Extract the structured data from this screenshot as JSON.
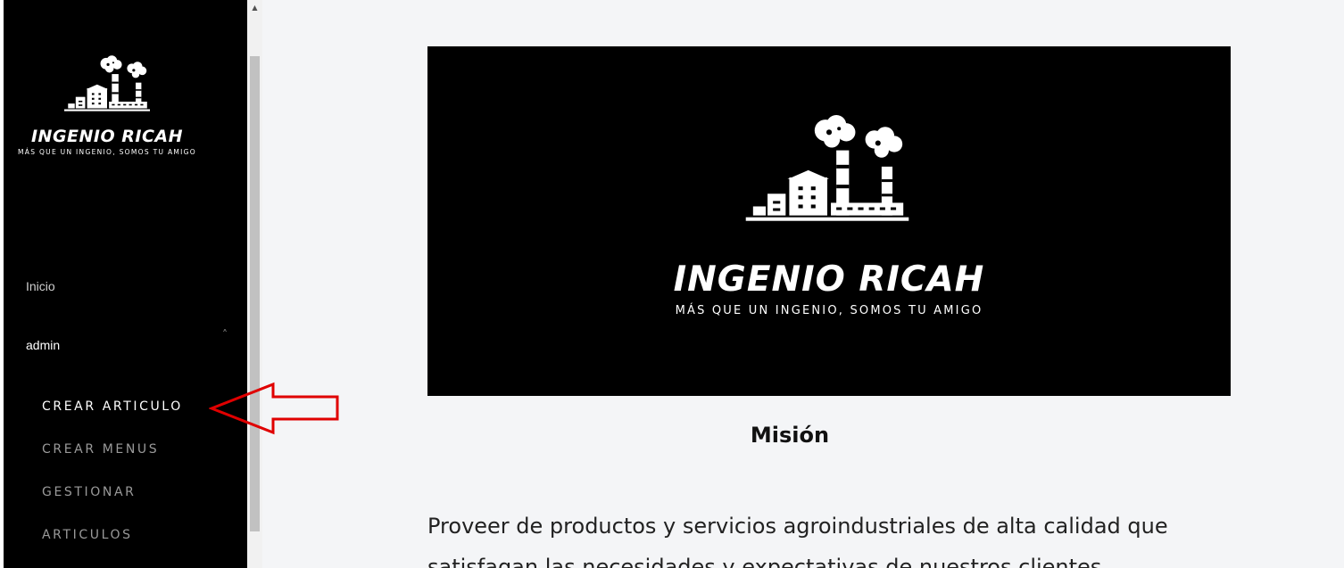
{
  "sidebar": {
    "brand": "INGENIO RICAH",
    "tagline": "MÁS QUE UN INGENIO, SOMOS TU AMIGO",
    "nav": [
      {
        "label": "Inicio"
      },
      {
        "label": "admin"
      }
    ],
    "submenu": [
      {
        "label": "CREAR ARTICULO"
      },
      {
        "label": "CREAR MENUS"
      },
      {
        "label": "GESTIONAR"
      },
      {
        "label": "ARTICULOS"
      }
    ]
  },
  "hero": {
    "brand": "INGENIO RICAH",
    "tagline": "MÁS QUE UN INGENIO, SOMOS TU AMIGO"
  },
  "content": {
    "heading": "Misión",
    "paragraph": "Proveer de productos y servicios agroindustriales de alta calidad que satisfagan las necesidades y expectativas de nuestros clientes."
  },
  "colors": {
    "sidebar_bg": "#000000",
    "page_bg": "#f4f5f7",
    "annotation_arrow": "#e00000"
  }
}
